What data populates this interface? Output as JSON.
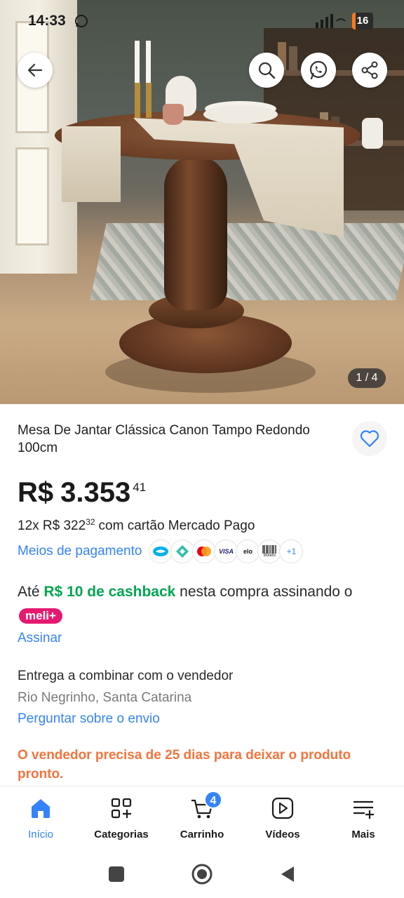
{
  "status_bar": {
    "time": "14:33",
    "battery": "16"
  },
  "gallery": {
    "counter": "1 / 4"
  },
  "product": {
    "title": "Mesa De Jantar Clássica Canon Tampo Redondo 100cm",
    "price_currency": "R$",
    "price_main": "3.353",
    "price_cents": "41",
    "installments_prefix": "12x R$ 322",
    "installments_cents": "32",
    "installments_suffix": "com cartão Mercado Pago",
    "payment_methods_label": "Meios de pagamento",
    "payment_badges": [
      "VISA",
      "elo",
      "Boleto",
      "+1"
    ]
  },
  "cashback": {
    "prefix": "Até",
    "highlight": "R$ 10 de cashback",
    "suffix": "nesta compra assinando o",
    "badge": "meli+",
    "subscribe_link": "Assinar"
  },
  "shipping": {
    "delivery": "Entrega a combinar com o vendedor",
    "location": "Rio Negrinho, Santa Catarina",
    "ask_link": "Perguntar sobre o envio",
    "seller_warning": "O vendedor precisa de 25 dias para deixar o produto pronto."
  },
  "tabs": [
    {
      "label": "Início",
      "active": true
    },
    {
      "label": "Categorias"
    },
    {
      "label": "Carrinho",
      "badge": "4"
    },
    {
      "label": "Vídeos"
    },
    {
      "label": "Mais"
    }
  ],
  "colors": {
    "accent_blue": "#3483fa",
    "cashback_green": "#00a650",
    "meli_pink": "#e5196f",
    "warning_orange": "#f5733c"
  }
}
